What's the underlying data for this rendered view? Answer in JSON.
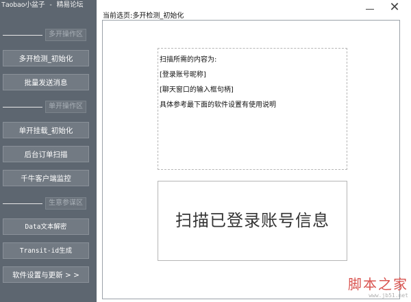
{
  "app": {
    "title": "Taobao小盆子 - 精易论坛"
  },
  "sidebar": {
    "sections": [
      {
        "label": "多开操作区"
      },
      {
        "label": "单开操作区"
      },
      {
        "label": "生意参谋区"
      }
    ],
    "buttons": [
      {
        "label": "多开检测_初始化"
      },
      {
        "label": "批量发送消息"
      },
      {
        "label": "单开挂载_初始化"
      },
      {
        "label": "后台订单扫描"
      },
      {
        "label": "千牛客户端监控"
      },
      {
        "label": "Data文本解密"
      },
      {
        "label": "Transit-id生成"
      },
      {
        "label": "软件设置与更新 > >"
      }
    ]
  },
  "window": {
    "minimize_glyph": "—",
    "close_glyph": "✕"
  },
  "main": {
    "breadcrumb": "当前选页:多开检测_初始化",
    "info_lines": [
      "扫描所需的内容为:",
      "[登录账号昵称]",
      "[聊天窗口的输入框句柄]",
      "具体参考最下面的软件设置有使用说明"
    ],
    "scan_button": "扫描已登录账号信息"
  },
  "watermark": {
    "text": "脚本之家",
    "url": "www.jb51.net"
  }
}
